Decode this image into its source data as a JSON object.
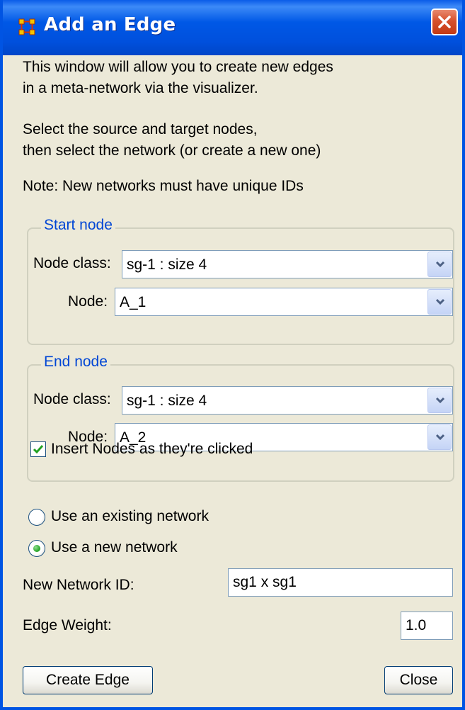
{
  "window": {
    "title": "Add an Edge",
    "icon": "network-app-icon",
    "close_icon": "close-icon"
  },
  "intro": {
    "line1": "This window will allow you to create new edges",
    "line2": "in a meta-network via the visualizer.",
    "line3": "Select the source and target nodes,",
    "line4": "then select the network (or create a new one)",
    "line5": "Note: New networks must have unique IDs"
  },
  "start_node": {
    "legend": "Start node",
    "node_class_label": "Node class:",
    "node_class_value": "sg-1 : size 4",
    "node_label": "Node:",
    "node_value": "A_1"
  },
  "end_node": {
    "legend": "End node",
    "node_class_label": "Node class:",
    "node_class_value": "sg-1 : size 4",
    "node_label": "Node:",
    "node_value": "A_2"
  },
  "insert_nodes": {
    "label": "Insert Nodes as they're clicked",
    "checked": true
  },
  "network_choice": {
    "existing_label": "Use an existing network",
    "new_label": "Use a new network",
    "selected": "new"
  },
  "new_network_id": {
    "label": "New Network ID:",
    "value": "sg1 x sg1"
  },
  "edge_weight": {
    "label": "Edge Weight:",
    "value": "1.0"
  },
  "buttons": {
    "create": "Create Edge",
    "close": "Close"
  },
  "colors": {
    "titlebar": "#0058e6",
    "dialog_bg": "#ece9d8",
    "legend": "#0046d5",
    "close_button": "#d6502c"
  }
}
